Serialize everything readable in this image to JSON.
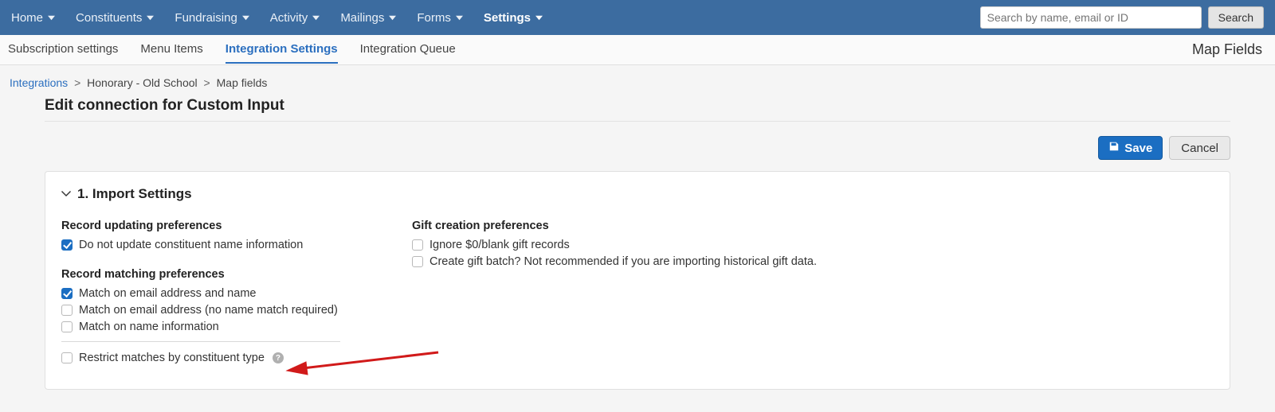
{
  "topnav": {
    "items": [
      {
        "label": "Home"
      },
      {
        "label": "Constituents"
      },
      {
        "label": "Fundraising"
      },
      {
        "label": "Activity"
      },
      {
        "label": "Mailings"
      },
      {
        "label": "Forms"
      },
      {
        "label": "Settings",
        "active": true
      }
    ],
    "search_placeholder": "Search by name, email or ID",
    "search_btn": "Search"
  },
  "subnav": {
    "items": [
      {
        "label": "Subscription settings"
      },
      {
        "label": "Menu Items"
      },
      {
        "label": "Integration Settings",
        "active": true
      },
      {
        "label": "Integration Queue"
      }
    ],
    "right_label": "Map Fields"
  },
  "breadcrumb": {
    "root": "Integrations",
    "mid": "Honorary - Old School",
    "leaf": "Map fields",
    "sep": ">"
  },
  "page_title": "Edit connection for Custom Input",
  "actions": {
    "save": "Save",
    "cancel": "Cancel"
  },
  "panel": {
    "title": "1. Import Settings",
    "left": {
      "group1_title": "Record updating preferences",
      "group1_opts": [
        {
          "label": "Do not update constituent name information",
          "checked": true
        }
      ],
      "group2_title": "Record matching preferences",
      "group2_opts": [
        {
          "label": "Match on email address and name",
          "checked": true
        },
        {
          "label": "Match on email address (no name match required)",
          "checked": false
        },
        {
          "label": "Match on name information",
          "checked": false
        }
      ],
      "restrict_label": "Restrict matches by constituent type",
      "restrict_checked": false
    },
    "right": {
      "group1_title": "Gift creation preferences",
      "group1_opts": [
        {
          "label": "Ignore $0/blank gift records",
          "checked": false
        },
        {
          "label": "Create gift batch? Not recommended if you are importing historical gift data.",
          "checked": false
        }
      ]
    }
  }
}
